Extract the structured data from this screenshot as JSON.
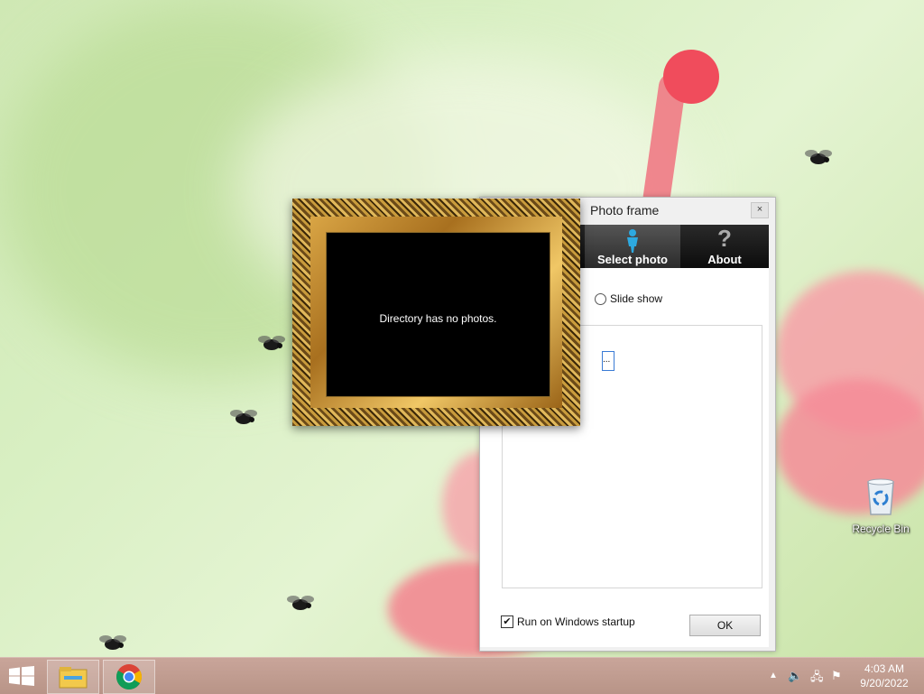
{
  "desktop": {
    "recycle_bin_label": "Recycle Bin"
  },
  "dialog": {
    "title": "Photo frame",
    "close_glyph": "×",
    "tabs": [
      {
        "label": "Select photo",
        "icon": "person-icon",
        "active": true
      },
      {
        "label": "About",
        "icon": "question-icon",
        "active": false
      }
    ],
    "slide_show_label": "Slide show",
    "browse_button_label": "...",
    "run_on_startup_label": "Run on Windows startup",
    "run_on_startup_checked": true,
    "ok_label": "OK"
  },
  "frame": {
    "message": "Directory has no photos."
  },
  "taskbar": {
    "time": "4:03 AM",
    "date": "9/20/2022",
    "pinned": [
      "file-explorer-icon",
      "chrome-icon"
    ]
  }
}
